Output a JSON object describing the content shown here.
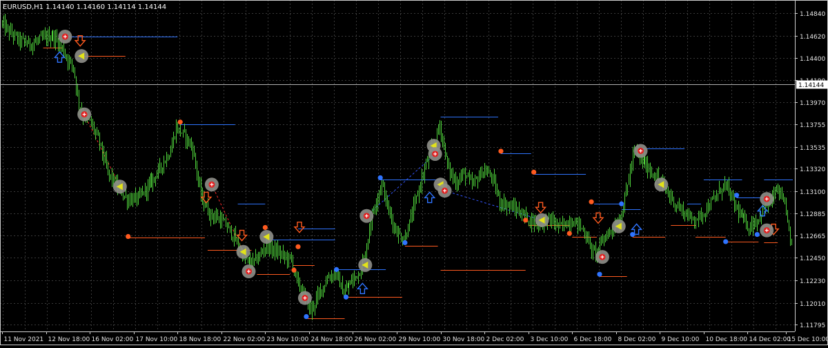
{
  "chart_data": {
    "type": "candlestick",
    "symbol_header": "EURUSD,H1  1.14140 1.14160 1.14114 1.14144",
    "current_price": 1.14144,
    "current_price_label": "1.14144",
    "ylim": [
      1.1173,
      1.1497
    ],
    "y_ticks": [
      {
        "value": 1.1484,
        "label": "1.14840"
      },
      {
        "value": 1.1462,
        "label": "1.14620"
      },
      {
        "value": 1.144,
        "label": "1.14400"
      },
      {
        "value": 1.1419,
        "label": "1.14190"
      },
      {
        "value": 1.1397,
        "label": "1.13970"
      },
      {
        "value": 1.13755,
        "label": "1.13755"
      },
      {
        "value": 1.13535,
        "label": "1.13535"
      },
      {
        "value": 1.1332,
        "label": "1.13320"
      },
      {
        "value": 1.131,
        "label": "1.13100"
      },
      {
        "value": 1.12885,
        "label": "1.12885"
      },
      {
        "value": 1.12665,
        "label": "1.12665"
      },
      {
        "value": 1.1245,
        "label": "1.12450"
      },
      {
        "value": 1.1223,
        "label": "1.12230"
      },
      {
        "value": 1.1201,
        "label": "1.12010"
      },
      {
        "value": 1.11795,
        "label": "1.11795"
      }
    ],
    "x_ticks": [
      {
        "bar": 0,
        "label": "11 Nov 2021"
      },
      {
        "bar": 32,
        "label": "12 Nov 18:00"
      },
      {
        "bar": 64,
        "label": "16 Nov 02:00"
      },
      {
        "bar": 96,
        "label": "17 Nov 10:00"
      },
      {
        "bar": 128,
        "label": "18 Nov 18:00"
      },
      {
        "bar": 160,
        "label": "22 Nov 02:00"
      },
      {
        "bar": 192,
        "label": "23 Nov 10:00"
      },
      {
        "bar": 224,
        "label": "24 Nov 18:00"
      },
      {
        "bar": 256,
        "label": "26 Nov 02:00"
      },
      {
        "bar": 288,
        "label": "29 Nov 10:00"
      },
      {
        "bar": 320,
        "label": "30 Nov 18:00"
      },
      {
        "bar": 352,
        "label": "2 Dec 02:00"
      },
      {
        "bar": 384,
        "label": "3 Dec 10:00"
      },
      {
        "bar": 416,
        "label": "6 Dec 18:00"
      },
      {
        "bar": 448,
        "label": "8 Dec 02:00"
      },
      {
        "bar": 480,
        "label": "9 Dec 10:00"
      },
      {
        "bar": 512,
        "label": "10 Dec 18:00"
      },
      {
        "bar": 544,
        "label": "14 Dec 02:00"
      },
      {
        "bar": 572,
        "label": "15 Dec 10:00"
      }
    ],
    "bars_total": 577,
    "price_path": [
      [
        0,
        1.1475
      ],
      [
        6,
        1.1466
      ],
      [
        14,
        1.1457
      ],
      [
        22,
        1.1454
      ],
      [
        30,
        1.1459
      ],
      [
        38,
        1.1462
      ],
      [
        44,
        1.1452
      ],
      [
        48,
        1.1441
      ],
      [
        53,
        1.1432
      ],
      [
        57,
        1.1394
      ],
      [
        60,
        1.1385
      ],
      [
        66,
        1.1376
      ],
      [
        72,
        1.1358
      ],
      [
        78,
        1.1328
      ],
      [
        86,
        1.1312
      ],
      [
        92,
        1.1302
      ],
      [
        100,
        1.1303
      ],
      [
        108,
        1.1316
      ],
      [
        116,
        1.1332
      ],
      [
        124,
        1.135
      ],
      [
        128,
        1.1372
      ],
      [
        134,
        1.1365
      ],
      [
        140,
        1.1352
      ],
      [
        146,
        1.1305
      ],
      [
        152,
        1.1288
      ],
      [
        158,
        1.1284
      ],
      [
        164,
        1.1277
      ],
      [
        170,
        1.1265
      ],
      [
        176,
        1.1248
      ],
      [
        182,
        1.1239
      ],
      [
        188,
        1.1245
      ],
      [
        194,
        1.1258
      ],
      [
        200,
        1.1252
      ],
      [
        206,
        1.1247
      ],
      [
        212,
        1.1243
      ],
      [
        216,
        1.1222
      ],
      [
        222,
        1.1205
      ],
      [
        226,
        1.1193
      ],
      [
        232,
        1.121
      ],
      [
        238,
        1.1225
      ],
      [
        244,
        1.123
      ],
      [
        250,
        1.121
      ],
      [
        256,
        1.1222
      ],
      [
        262,
        1.1232
      ],
      [
        266,
        1.1248
      ],
      [
        270,
        1.1282
      ],
      [
        274,
        1.1302
      ],
      [
        278,
        1.1318
      ],
      [
        282,
        1.1295
      ],
      [
        288,
        1.1272
      ],
      [
        294,
        1.1262
      ],
      [
        300,
        1.1288
      ],
      [
        306,
        1.1318
      ],
      [
        312,
        1.1345
      ],
      [
        316,
        1.1358
      ],
      [
        320,
        1.1374
      ],
      [
        326,
        1.1335
      ],
      [
        332,
        1.1318
      ],
      [
        338,
        1.1328
      ],
      [
        344,
        1.1316
      ],
      [
        352,
        1.133
      ],
      [
        358,
        1.1325
      ],
      [
        364,
        1.13
      ],
      [
        372,
        1.1295
      ],
      [
        380,
        1.1288
      ],
      [
        386,
        1.1282
      ],
      [
        392,
        1.1278
      ],
      [
        400,
        1.1283
      ],
      [
        408,
        1.1275
      ],
      [
        414,
        1.128
      ],
      [
        420,
        1.128
      ],
      [
        426,
        1.127
      ],
      [
        432,
        1.125
      ],
      [
        436,
        1.1252
      ],
      [
        440,
        1.1265
      ],
      [
        446,
        1.1273
      ],
      [
        452,
        1.1283
      ],
      [
        456,
        1.131
      ],
      [
        462,
        1.135
      ],
      [
        468,
        1.134
      ],
      [
        474,
        1.133
      ],
      [
        480,
        1.1322
      ],
      [
        486,
        1.131
      ],
      [
        492,
        1.1298
      ],
      [
        498,
        1.129
      ],
      [
        504,
        1.1283
      ],
      [
        510,
        1.1285
      ],
      [
        516,
        1.1295
      ],
      [
        522,
        1.1305
      ],
      [
        528,
        1.1318
      ],
      [
        534,
        1.13
      ],
      [
        540,
        1.1285
      ],
      [
        546,
        1.1275
      ],
      [
        552,
        1.1282
      ],
      [
        558,
        1.1295
      ],
      [
        562,
        1.13
      ],
      [
        566,
        1.1312
      ],
      [
        570,
        1.1302
      ],
      [
        574,
        1.1285
      ],
      [
        576,
        1.126
      ],
      [
        577,
        1.1262
      ]
    ],
    "level_lines": [
      {
        "color": "#2f74ff",
        "b0": 45,
        "b1": 128,
        "price": 1.14612
      },
      {
        "color": "#ff5a1f",
        "b0": 30,
        "b1": 44,
        "price": 1.14505
      },
      {
        "color": "#ff5a1f",
        "b0": 55,
        "b1": 90,
        "price": 1.14422
      },
      {
        "color": "#2f74ff",
        "b0": 130,
        "b1": 170,
        "price": 1.13757
      },
      {
        "color": "#ff5a1f",
        "b0": 92,
        "b1": 148,
        "price": 1.12648
      },
      {
        "color": "#2f74ff",
        "b0": 172,
        "b1": 192,
        "price": 1.12977
      },
      {
        "color": "#2f74ff",
        "b0": 192,
        "b1": 243,
        "price": 1.12628
      },
      {
        "color": "#ff5a1f",
        "b0": 150,
        "b1": 182,
        "price": 1.12526
      },
      {
        "color": "#ff5a1f",
        "b0": 186,
        "b1": 210,
        "price": 1.1229
      },
      {
        "color": "#ff5a1f",
        "b0": 212,
        "b1": 228,
        "price": 1.1238
      },
      {
        "color": "#2f74ff",
        "b0": 216,
        "b1": 243,
        "price": 1.12738
      },
      {
        "color": "#2f74ff",
        "b0": 244,
        "b1": 280,
        "price": 1.12335
      },
      {
        "color": "#ff5a1f",
        "b0": 223,
        "b1": 250,
        "price": 1.11855
      },
      {
        "color": "#ff5a1f",
        "b0": 252,
        "b1": 292,
        "price": 1.12066
      },
      {
        "color": "#2f74ff",
        "b0": 276,
        "b1": 320,
        "price": 1.13212
      },
      {
        "color": "#ff5a1f",
        "b0": 294,
        "b1": 318,
        "price": 1.12568
      },
      {
        "color": "#2f74ff",
        "b0": 320,
        "b1": 362,
        "price": 1.13827
      },
      {
        "color": "#2f74ff",
        "b0": 364,
        "b1": 386,
        "price": 1.13472
      },
      {
        "color": "#2f74ff",
        "b0": 388,
        "b1": 426,
        "price": 1.13267
      },
      {
        "color": "#ff5a1f",
        "b0": 320,
        "b1": 382,
        "price": 1.12329
      },
      {
        "color": "#ff5a1f",
        "b0": 384,
        "b1": 414,
        "price": 1.12768
      },
      {
        "color": "#ff5a1f",
        "b0": 416,
        "b1": 434,
        "price": 1.12658
      },
      {
        "color": "#2f74ff",
        "b0": 432,
        "b1": 452,
        "price": 1.12977
      },
      {
        "color": "#2f74ff",
        "b0": 452,
        "b1": 466,
        "price": 1.12928
      },
      {
        "color": "#ff5a1f",
        "b0": 436,
        "b1": 456,
        "price": 1.12269
      },
      {
        "color": "#ff5a1f",
        "b0": 460,
        "b1": 484,
        "price": 1.12658
      },
      {
        "color": "#2f74ff",
        "b0": 466,
        "b1": 498,
        "price": 1.13522
      },
      {
        "color": "#ff5a1f",
        "b0": 488,
        "b1": 506,
        "price": 1.12768
      },
      {
        "color": "#2f74ff",
        "b0": 500,
        "b1": 510,
        "price": 1.12977
      },
      {
        "color": "#ff5a1f",
        "b0": 506,
        "b1": 528,
        "price": 1.12658
      },
      {
        "color": "#2f74ff",
        "b0": 512,
        "b1": 540,
        "price": 1.13212
      },
      {
        "color": "#ff5a1f",
        "b0": 528,
        "b1": 552,
        "price": 1.12608
      },
      {
        "color": "#2f74ff",
        "b0": 536,
        "b1": 556,
        "price": 1.13042
      },
      {
        "color": "#2f74ff",
        "b0": 556,
        "b1": 577,
        "price": 1.13212
      },
      {
        "color": "#ff5a1f",
        "b0": 556,
        "b1": 566,
        "price": 1.12598
      }
    ],
    "swing_points": [
      {
        "color": "#ff5a1f",
        "b": 130,
        "price": 1.13777
      },
      {
        "color": "#ff5a1f",
        "b": 92,
        "price": 1.12658
      },
      {
        "color": "#ff5a1f",
        "b": 216,
        "price": 1.12558
      },
      {
        "color": "#ff5a1f",
        "b": 213,
        "price": 1.12329
      },
      {
        "color": "#ff5a1f",
        "b": 192,
        "price": 1.12746
      },
      {
        "color": "#2f74ff",
        "b": 244,
        "price": 1.12335
      },
      {
        "color": "#2f74ff",
        "b": 222,
        "price": 1.11875
      },
      {
        "color": "#2f74ff",
        "b": 251,
        "price": 1.12066
      },
      {
        "color": "#2f74ff",
        "b": 276,
        "price": 1.13232
      },
      {
        "color": "#2f74ff",
        "b": 294,
        "price": 1.12598
      },
      {
        "color": "#ff5a1f",
        "b": 364,
        "price": 1.13492
      },
      {
        "color": "#ff5a1f",
        "b": 388,
        "price": 1.13287
      },
      {
        "color": "#ff5a1f",
        "b": 382,
        "price": 1.12818
      },
      {
        "color": "#ff5a1f",
        "b": 414,
        "price": 1.12688
      },
      {
        "color": "#ff5a1f",
        "b": 430,
        "price": 1.12997
      },
      {
        "color": "#2f74ff",
        "b": 452,
        "price": 1.12977
      },
      {
        "color": "#2f74ff",
        "b": 460,
        "price": 1.12678
      },
      {
        "color": "#2f74ff",
        "b": 436,
        "price": 1.12289
      },
      {
        "color": "#2f74ff",
        "b": 528,
        "price": 1.12608
      },
      {
        "color": "#2f74ff",
        "b": 536,
        "price": 1.13062
      },
      {
        "color": "#2f74ff",
        "b": 551,
        "price": 1.12678
      }
    ],
    "signal_markers": [
      {
        "type": "buy",
        "b": 46,
        "price": 1.14612
      },
      {
        "type": "sell",
        "b": 58,
        "price": 1.14422
      },
      {
        "type": "buy",
        "b": 60,
        "price": 1.13852
      },
      {
        "type": "sell",
        "b": 86,
        "price": 1.13146
      },
      {
        "type": "buy",
        "b": 153,
        "price": 1.13166
      },
      {
        "type": "sell",
        "b": 176,
        "price": 1.12508
      },
      {
        "type": "buy",
        "b": 180,
        "price": 1.12317
      },
      {
        "type": "sell",
        "b": 193,
        "price": 1.12655
      },
      {
        "type": "buy",
        "b": 221,
        "price": 1.12057
      },
      {
        "type": "sell",
        "b": 265,
        "price": 1.12379
      },
      {
        "type": "buy",
        "b": 266,
        "price": 1.12859
      },
      {
        "type": "sell",
        "b": 315,
        "price": 1.13545
      },
      {
        "type": "buy",
        "b": 316,
        "price": 1.13465
      },
      {
        "type": "sell",
        "b": 320,
        "price": 1.13166
      },
      {
        "type": "buy",
        "b": 323,
        "price": 1.13106
      },
      {
        "type": "sell",
        "b": 394,
        "price": 1.12818
      },
      {
        "type": "buy",
        "b": 438,
        "price": 1.12458
      },
      {
        "type": "sell",
        "b": 450,
        "price": 1.12758
      },
      {
        "type": "buy",
        "b": 466,
        "price": 1.13495
      },
      {
        "type": "sell",
        "b": 481,
        "price": 1.13166
      },
      {
        "type": "buy",
        "b": 558,
        "price": 1.13025
      },
      {
        "type": "buy",
        "b": 558,
        "price": 1.12718
      }
    ],
    "arrows": [
      {
        "dir": "down",
        "color": "#ff5a1f",
        "b": 57,
        "price": 1.1456
      },
      {
        "dir": "up",
        "color": "#2f74ff",
        "b": 42,
        "price": 1.14422
      },
      {
        "dir": "down",
        "color": "#ff5a1f",
        "b": 149,
        "price": 1.1303
      },
      {
        "dir": "down",
        "color": "#ff5a1f",
        "b": 175,
        "price": 1.12658
      },
      {
        "dir": "down",
        "color": "#ff5a1f",
        "b": 217,
        "price": 1.12738
      },
      {
        "dir": "up",
        "color": "#2f74ff",
        "b": 263,
        "price": 1.1216
      },
      {
        "dir": "up",
        "color": "#2f74ff",
        "b": 312,
        "price": 1.1305
      },
      {
        "dir": "down",
        "color": "#ff5a1f",
        "b": 393,
        "price": 1.1293
      },
      {
        "dir": "down",
        "color": "#ff5a1f",
        "b": 435,
        "price": 1.12828
      },
      {
        "dir": "up",
        "color": "#2f74ff",
        "b": 463,
        "price": 1.1274
      },
      {
        "dir": "up",
        "color": "#2f74ff",
        "b": 555,
        "price": 1.1292
      },
      {
        "dir": "down",
        "color": "#ff5a1f",
        "b": 563,
        "price": 1.12718
      }
    ],
    "dashed_links": [
      {
        "color": "#ff2a2a",
        "b0": 60,
        "p0": 1.13852,
        "b1": 86,
        "p1": 1.13146
      },
      {
        "color": "#ff2a2a",
        "b0": 153,
        "p0": 1.13166,
        "b1": 176,
        "p1": 1.12508
      },
      {
        "color": "#3355ff",
        "b0": 266,
        "p0": 1.12859,
        "b1": 316,
        "p1": 1.13465
      },
      {
        "color": "#3355ff",
        "b0": 323,
        "p0": 1.13106,
        "b1": 394,
        "p1": 1.12818
      }
    ]
  }
}
